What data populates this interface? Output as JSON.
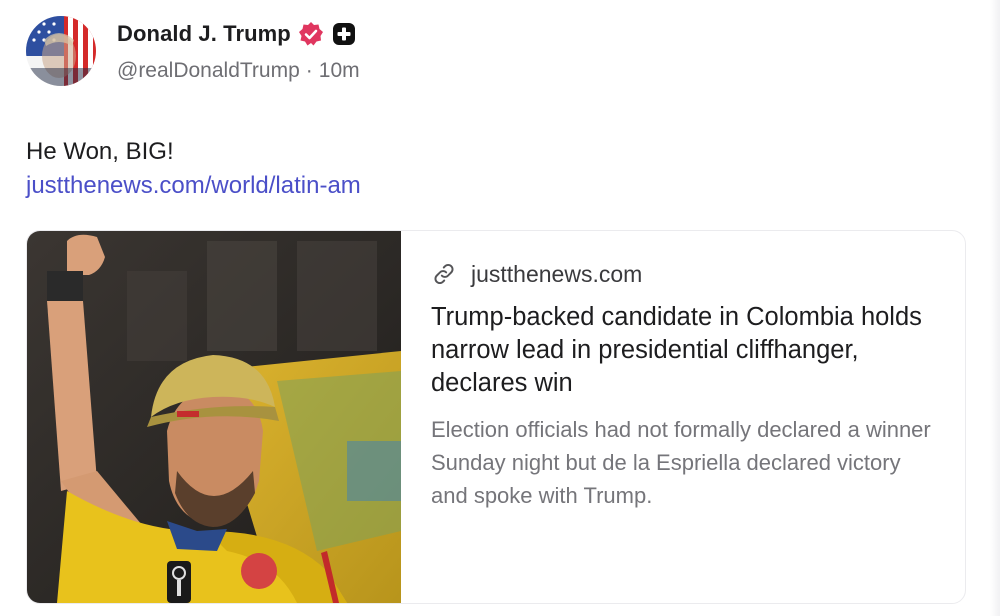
{
  "post": {
    "author": {
      "display_name": "Donald J. Trump",
      "handle": "@realDonaldTrump",
      "time_ago": "10m",
      "separator": "·",
      "verified_icon": "verified-badge-icon",
      "plus_icon": "plus-badge-icon"
    },
    "text": "He Won, BIG!",
    "link_text": "justthenews.com/world/latin-am"
  },
  "link_card": {
    "domain": "justthenews.com",
    "link_icon": "link-icon",
    "title": "Trump-backed candidate in Colombia holds narrow lead in presidential cliffhanger, declares win",
    "description": "Election officials had not formally declared a winner Sunday night but de la Espriella declared victory and spoke with Trump."
  },
  "colors": {
    "link": "#4b4fc8",
    "verified_badge": "#e0365f",
    "plus_badge": "#111111",
    "jersey_yellow": "#e8c21c"
  }
}
